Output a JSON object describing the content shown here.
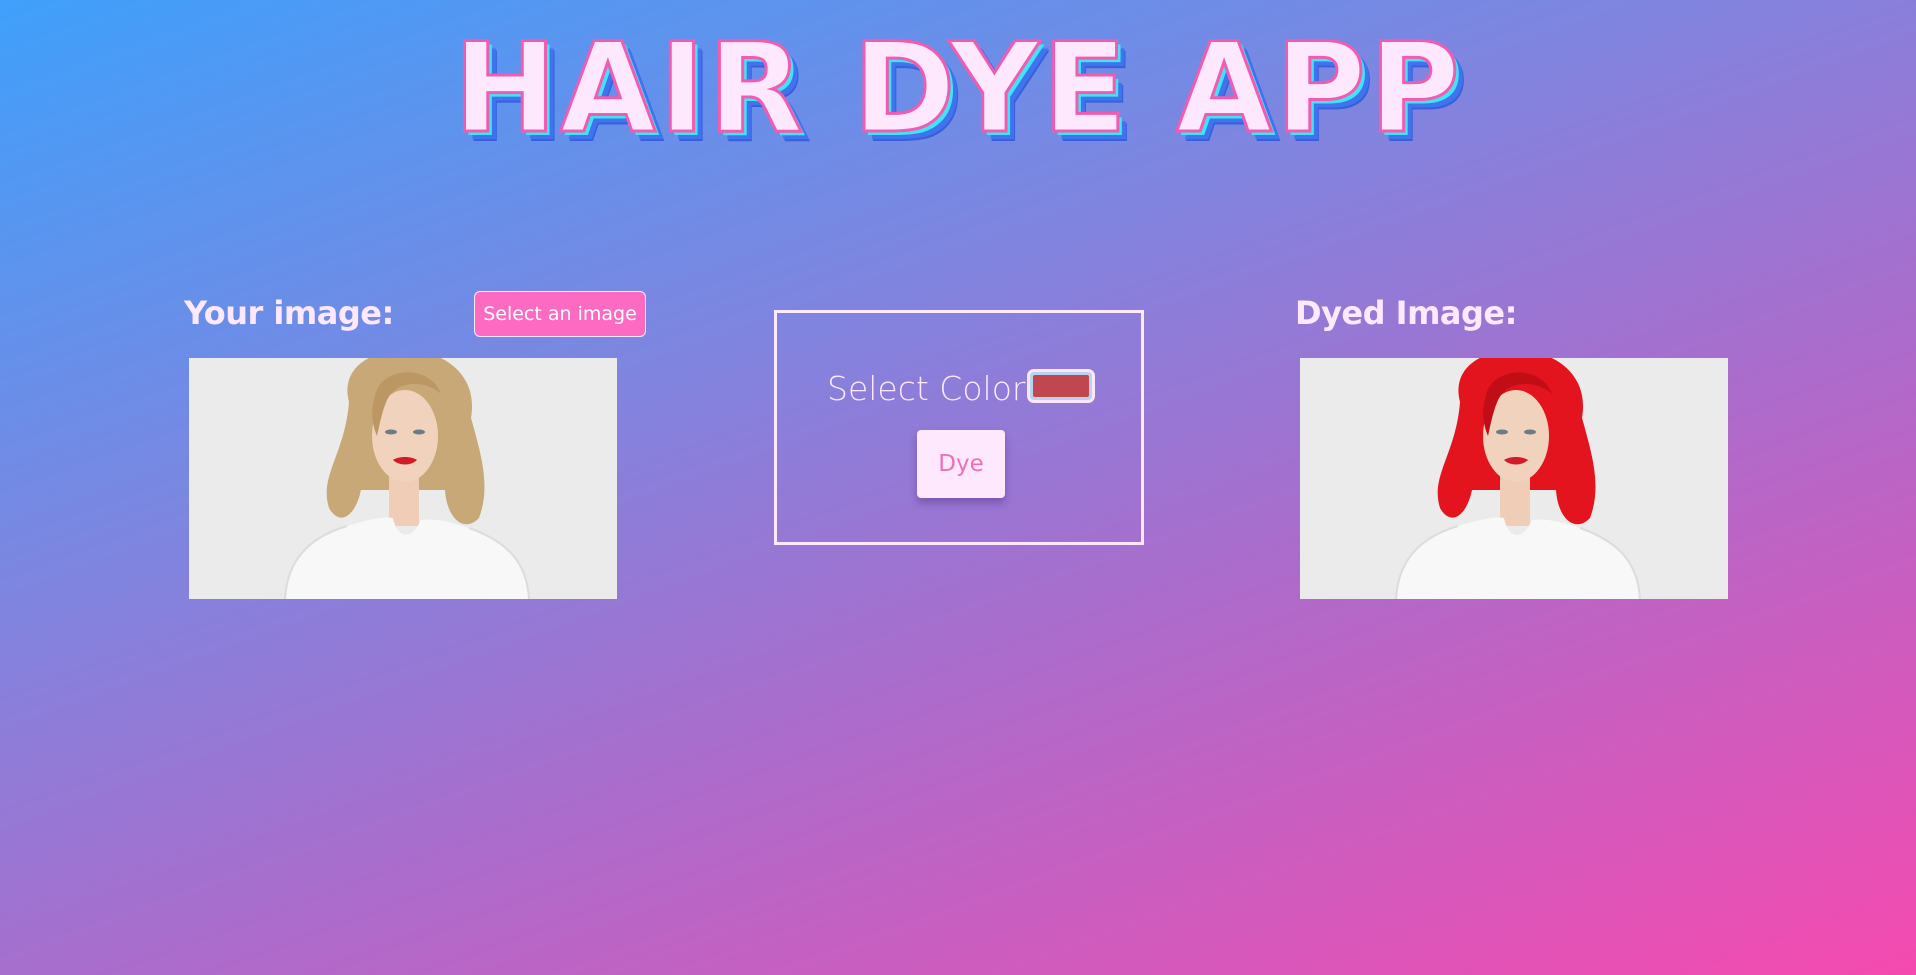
{
  "header": {
    "title": "HAIR DYE APP"
  },
  "original": {
    "label": "Your image:",
    "select_button_label": "Select an image"
  },
  "controls": {
    "select_color_label": "Select Color",
    "selected_color": "#c0464f",
    "dye_button_label": "Dye"
  },
  "dyed": {
    "label": "Dyed Image:"
  },
  "colors": {
    "title_fill": "#fde8fe",
    "title_outline": "#f25bb0",
    "accent_button": "#fc6bc1",
    "original_hair": "#c9a878",
    "dyed_hair": "#e4141e"
  }
}
